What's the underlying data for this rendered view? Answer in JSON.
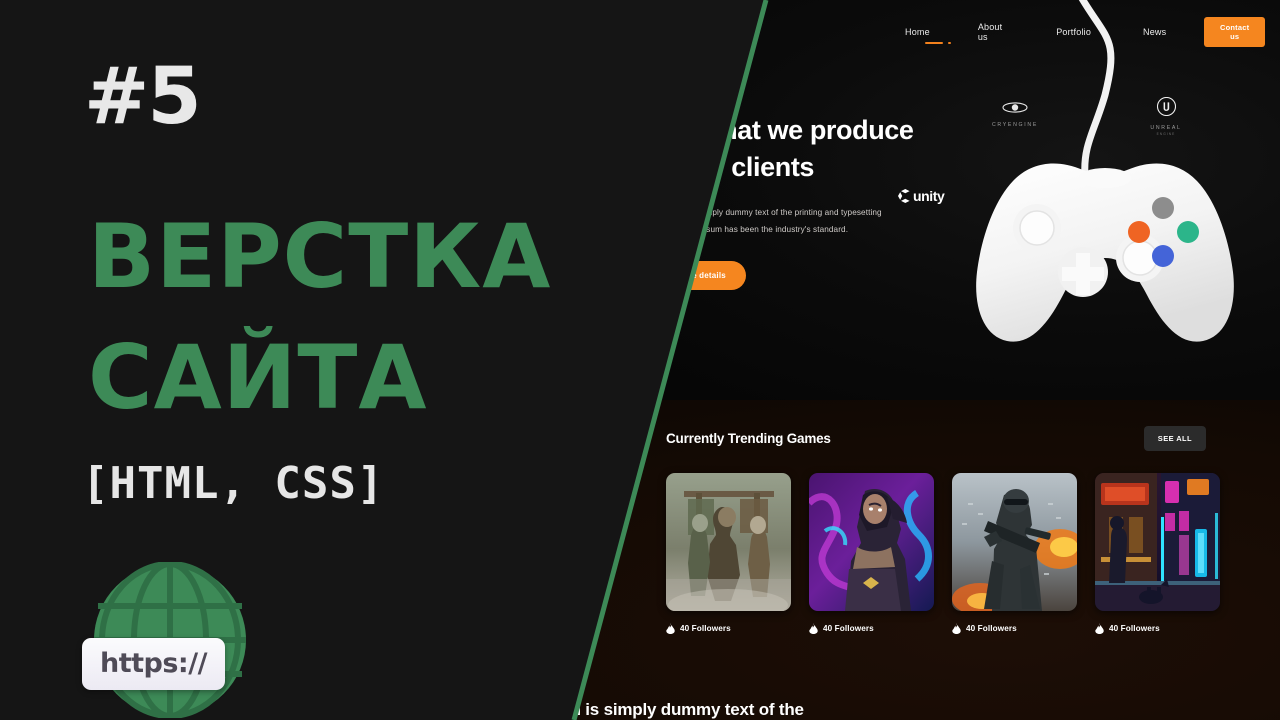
{
  "thumbnail": {
    "episode": "#5",
    "title_line1": "ВЕРСТКА",
    "title_line2": "САЙТА",
    "tags": "[HTML, CSS]",
    "url_badge": "https://",
    "colors": {
      "green": "#3d8a57",
      "background": "#151515",
      "text": "#e8e8e8"
    }
  },
  "website": {
    "nav": {
      "items": [
        {
          "label": "Home",
          "active": true
        },
        {
          "label": "About us",
          "active": false
        },
        {
          "label": "Portfolio",
          "active": false
        },
        {
          "label": "News",
          "active": false
        }
      ],
      "cta_label": "Contact us",
      "accent": "#f5861f"
    },
    "hero": {
      "heading": "Work that we produce for our clients",
      "paragraph": "Lorem ipsum is simply dummy text of the printing and typesetting industry. Lorem ipsum has been the industry's standard.",
      "cta_label": "Get more details"
    },
    "engines": [
      {
        "name": "CRYENGINE",
        "caption": "CRYENGINE",
        "subcaption": ""
      },
      {
        "name": "UNREAL",
        "caption": "UNREAL",
        "subcaption": "ENGINE"
      },
      {
        "name": "unity",
        "caption": "unity",
        "subcaption": ""
      }
    ],
    "trending": {
      "title": "Currently Trending Games",
      "see_all_label": "SEE ALL",
      "cards": [
        {
          "alt": "warriors-battle-artwork",
          "followers": "40 Followers"
        },
        {
          "alt": "neon-purple-assassin-artwork",
          "followers": "40 Followers"
        },
        {
          "alt": "soldier-explosion-artwork",
          "followers": "40 Followers"
        },
        {
          "alt": "cyberpunk-neon-street-artwork",
          "followers": "40 Followers"
        }
      ]
    },
    "footer_teaser": "Lorem Ipsum is simply dummy text of the"
  }
}
